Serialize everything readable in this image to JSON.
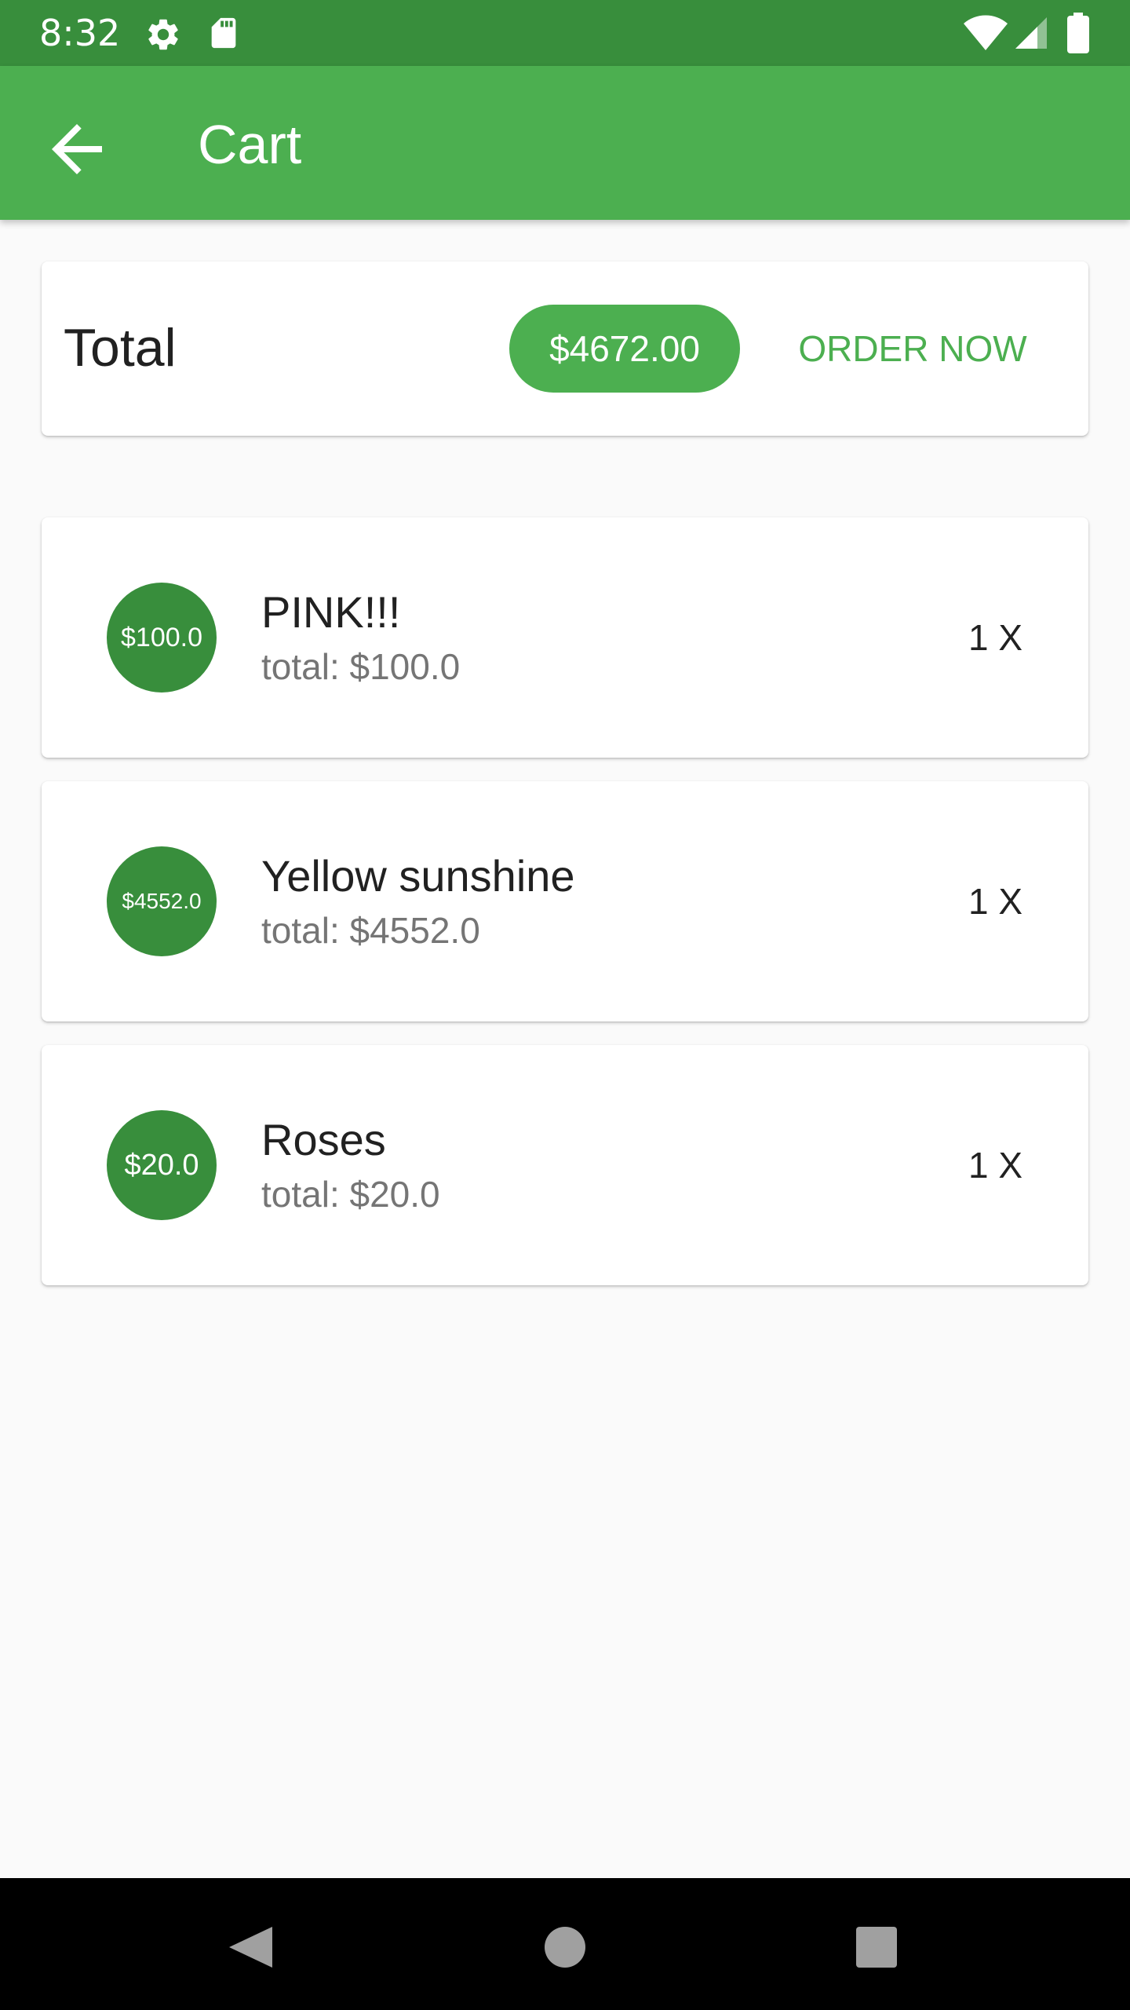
{
  "status_bar": {
    "time": "8:32",
    "left_icons": [
      "settings-icon",
      "sd-card-icon"
    ],
    "right_icons": [
      "wifi-icon",
      "cell-signal-icon",
      "battery-icon"
    ]
  },
  "app_bar": {
    "title": "Cart",
    "back_icon": "arrow-back-icon"
  },
  "total": {
    "label": "Total",
    "amount": "$4672.00",
    "order_button": "ORDER NOW"
  },
  "items": [
    {
      "price_badge": "$100.0",
      "title": "PINK!!!",
      "subtitle": "total: $100.0",
      "quantity": "1 X"
    },
    {
      "price_badge": "$4552.0",
      "title": "Yellow sunshine",
      "subtitle": "total: $4552.0",
      "quantity": "1 X"
    },
    {
      "price_badge": "$20.0",
      "title": "Roses",
      "subtitle": "total: $20.0",
      "quantity": "1 X"
    }
  ],
  "nav_bar": {
    "icons": [
      "back-triangle-icon",
      "home-circle-icon",
      "recents-square-icon"
    ]
  },
  "colors": {
    "status_bar": "#388e3c",
    "app_bar": "#4caf50",
    "accent": "#4caf50",
    "avatar": "#388e3c",
    "background": "#fafafa"
  }
}
